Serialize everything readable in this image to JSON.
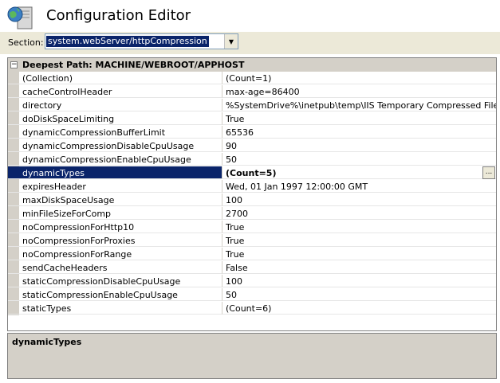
{
  "app": {
    "title": "Configuration Editor",
    "icon": "iis-globe-server-icon"
  },
  "section": {
    "label": "Section:",
    "value": "system.webServer/httpCompression"
  },
  "grid": {
    "header": "Deepest Path: MACHINE/WEBROOT/APPHOST",
    "rows": [
      {
        "name": "(Collection)",
        "value": "(Count=1)"
      },
      {
        "name": "cacheControlHeader",
        "value": "max-age=86400"
      },
      {
        "name": "directory",
        "value": "%SystemDrive%\\inetpub\\temp\\IIS Temporary Compressed Files"
      },
      {
        "name": "doDiskSpaceLimiting",
        "value": "True"
      },
      {
        "name": "dynamicCompressionBufferLimit",
        "value": "65536"
      },
      {
        "name": "dynamicCompressionDisableCpuUsage",
        "value": "90"
      },
      {
        "name": "dynamicCompressionEnableCpuUsage",
        "value": "50"
      },
      {
        "name": "dynamicTypes",
        "value": "(Count=5)"
      },
      {
        "name": "expiresHeader",
        "value": "Wed, 01 Jan 1997 12:00:00 GMT"
      },
      {
        "name": "maxDiskSpaceUsage",
        "value": "100"
      },
      {
        "name": "minFileSizeForComp",
        "value": "2700"
      },
      {
        "name": "noCompressionForHttp10",
        "value": "True"
      },
      {
        "name": "noCompressionForProxies",
        "value": "True"
      },
      {
        "name": "noCompressionForRange",
        "value": "True"
      },
      {
        "name": "sendCacheHeaders",
        "value": "False"
      },
      {
        "name": "staticCompressionDisableCpuUsage",
        "value": "100"
      },
      {
        "name": "staticCompressionEnableCpuUsage",
        "value": "50"
      },
      {
        "name": "staticTypes",
        "value": "(Count=6)"
      }
    ],
    "selected_index": 7,
    "ellipsis_label": "..."
  },
  "description": {
    "title": "dynamicTypes"
  },
  "colors": {
    "selection": "#0a246a",
    "panel": "#d4d0c8"
  }
}
